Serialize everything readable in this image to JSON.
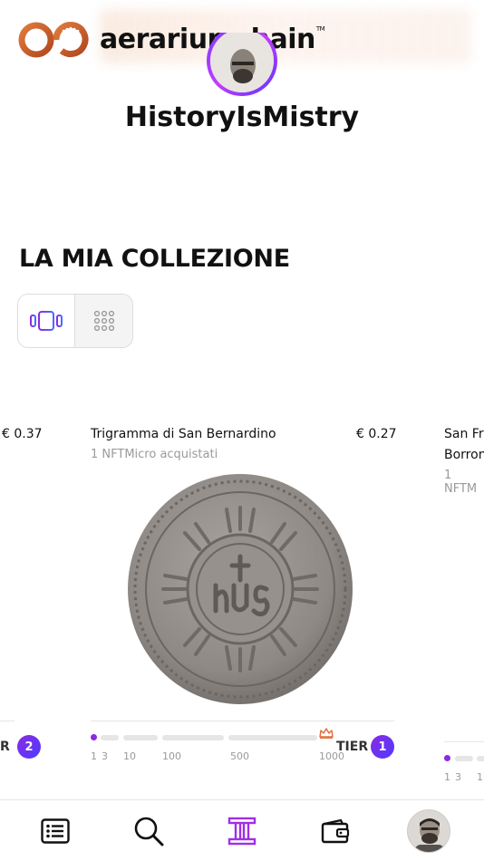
{
  "brand": {
    "name": "aerariumchain",
    "tm": "TM",
    "accent": "#c9642e"
  },
  "profile": {
    "username": "HistoryIsMistry"
  },
  "collection": {
    "title": "LA MIA COLLEZIONE",
    "view_modes": [
      "carousel-icon",
      "grid-icon"
    ],
    "active_view": "carousel"
  },
  "cards": {
    "left": {
      "price": "€ 0.37",
      "tier_label": "R",
      "tier_number": "2"
    },
    "center": {
      "title": "Trigramma di San Bernardino",
      "subtitle": "1 NFTMicro acquistati",
      "price": "€ 0.27",
      "tier_label": "TIER",
      "tier_number": "1",
      "progress_ticks": [
        "1",
        "3",
        "10",
        "100",
        "500",
        "1000"
      ],
      "progress_value": 1
    },
    "right": {
      "title_line1": "San Fr",
      "title_line2": "Borron",
      "subtitle": "1 NFTM",
      "progress_ticks": [
        "1",
        "3",
        "1("
      ]
    }
  },
  "nav": {
    "items": [
      "list-icon",
      "search-icon",
      "collection-column-icon",
      "wallet-icon",
      "profile-avatar"
    ],
    "active": "collection-column-icon",
    "active_color": "#a12ee8"
  }
}
